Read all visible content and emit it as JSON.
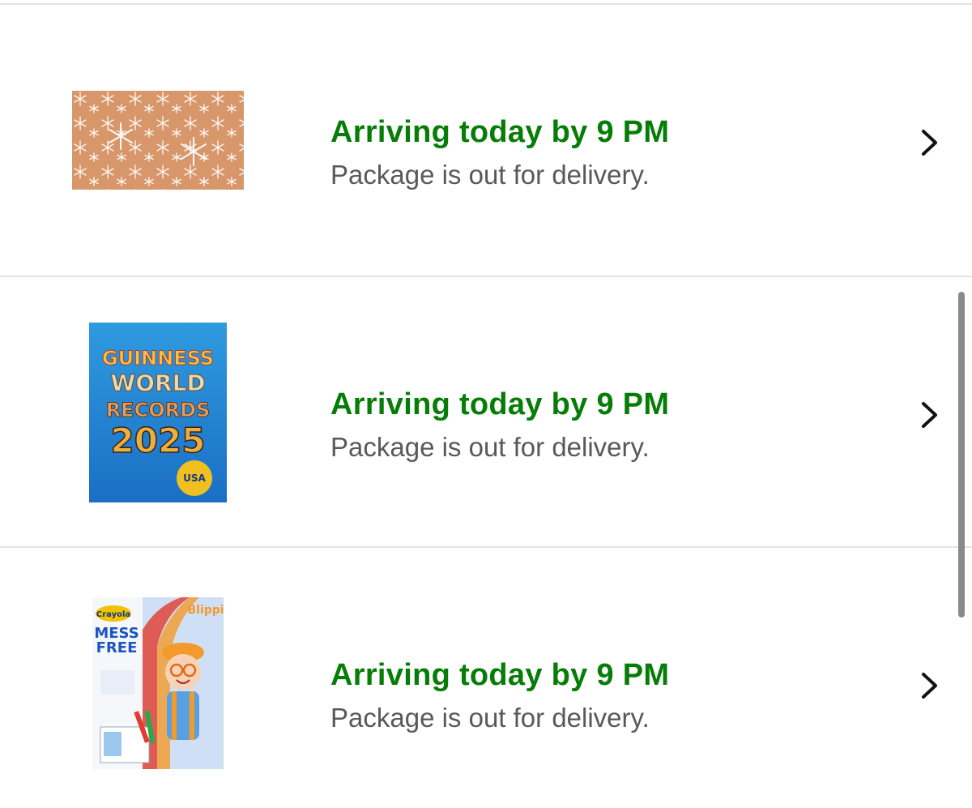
{
  "orders": [
    {
      "status_title": "Arriving today by 9 PM",
      "status_subtitle": "Package is out for delivery.",
      "product_icon": "snowflake-doormat-image"
    },
    {
      "status_title": "Arriving today by 9 PM",
      "status_subtitle": "Package is out for delivery.",
      "product_icon": "guinness-world-records-book-image",
      "product_image_text": {
        "line1": "GUINNESS",
        "line2": "WORLD",
        "line3": "RECORDS",
        "line4": "2025",
        "badge": "USA"
      }
    },
    {
      "status_title": "Arriving today by 9 PM",
      "status_subtitle": "Package is out for delivery.",
      "product_icon": "crayola-blippi-coloring-book-image",
      "product_image_text": {
        "brand": "Crayola",
        "title1": "MESS",
        "title2": "FREE",
        "character": "Blippi"
      }
    }
  ],
  "colors": {
    "status_green": "#067d06",
    "subtitle_gray": "#595959",
    "divider": "#e3e3e3"
  }
}
